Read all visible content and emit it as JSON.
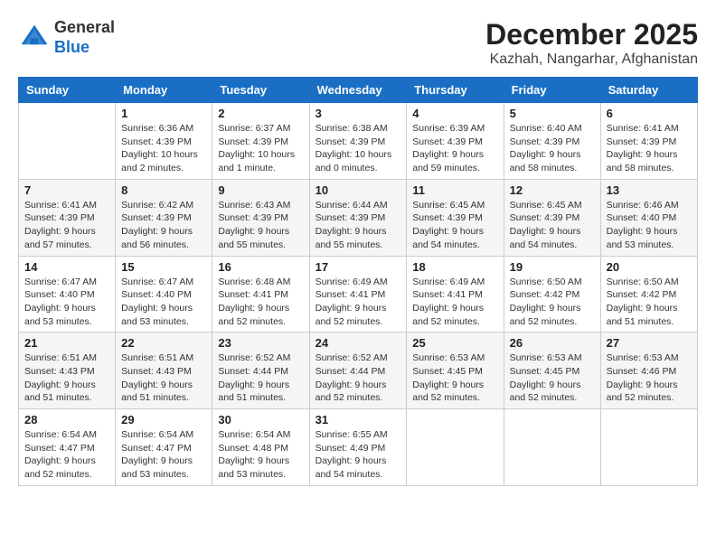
{
  "header": {
    "logo_line1": "General",
    "logo_line2": "Blue",
    "month": "December 2025",
    "location": "Kazhah, Nangarhar, Afghanistan"
  },
  "calendar": {
    "days_of_week": [
      "Sunday",
      "Monday",
      "Tuesday",
      "Wednesday",
      "Thursday",
      "Friday",
      "Saturday"
    ],
    "weeks": [
      [
        {
          "day": "",
          "info": ""
        },
        {
          "day": "1",
          "info": "Sunrise: 6:36 AM\nSunset: 4:39 PM\nDaylight: 10 hours\nand 2 minutes."
        },
        {
          "day": "2",
          "info": "Sunrise: 6:37 AM\nSunset: 4:39 PM\nDaylight: 10 hours\nand 1 minute."
        },
        {
          "day": "3",
          "info": "Sunrise: 6:38 AM\nSunset: 4:39 PM\nDaylight: 10 hours\nand 0 minutes."
        },
        {
          "day": "4",
          "info": "Sunrise: 6:39 AM\nSunset: 4:39 PM\nDaylight: 9 hours\nand 59 minutes."
        },
        {
          "day": "5",
          "info": "Sunrise: 6:40 AM\nSunset: 4:39 PM\nDaylight: 9 hours\nand 58 minutes."
        },
        {
          "day": "6",
          "info": "Sunrise: 6:41 AM\nSunset: 4:39 PM\nDaylight: 9 hours\nand 58 minutes."
        }
      ],
      [
        {
          "day": "7",
          "info": "Sunrise: 6:41 AM\nSunset: 4:39 PM\nDaylight: 9 hours\nand 57 minutes."
        },
        {
          "day": "8",
          "info": "Sunrise: 6:42 AM\nSunset: 4:39 PM\nDaylight: 9 hours\nand 56 minutes."
        },
        {
          "day": "9",
          "info": "Sunrise: 6:43 AM\nSunset: 4:39 PM\nDaylight: 9 hours\nand 55 minutes."
        },
        {
          "day": "10",
          "info": "Sunrise: 6:44 AM\nSunset: 4:39 PM\nDaylight: 9 hours\nand 55 minutes."
        },
        {
          "day": "11",
          "info": "Sunrise: 6:45 AM\nSunset: 4:39 PM\nDaylight: 9 hours\nand 54 minutes."
        },
        {
          "day": "12",
          "info": "Sunrise: 6:45 AM\nSunset: 4:39 PM\nDaylight: 9 hours\nand 54 minutes."
        },
        {
          "day": "13",
          "info": "Sunrise: 6:46 AM\nSunset: 4:40 PM\nDaylight: 9 hours\nand 53 minutes."
        }
      ],
      [
        {
          "day": "14",
          "info": "Sunrise: 6:47 AM\nSunset: 4:40 PM\nDaylight: 9 hours\nand 53 minutes."
        },
        {
          "day": "15",
          "info": "Sunrise: 6:47 AM\nSunset: 4:40 PM\nDaylight: 9 hours\nand 53 minutes."
        },
        {
          "day": "16",
          "info": "Sunrise: 6:48 AM\nSunset: 4:41 PM\nDaylight: 9 hours\nand 52 minutes."
        },
        {
          "day": "17",
          "info": "Sunrise: 6:49 AM\nSunset: 4:41 PM\nDaylight: 9 hours\nand 52 minutes."
        },
        {
          "day": "18",
          "info": "Sunrise: 6:49 AM\nSunset: 4:41 PM\nDaylight: 9 hours\nand 52 minutes."
        },
        {
          "day": "19",
          "info": "Sunrise: 6:50 AM\nSunset: 4:42 PM\nDaylight: 9 hours\nand 52 minutes."
        },
        {
          "day": "20",
          "info": "Sunrise: 6:50 AM\nSunset: 4:42 PM\nDaylight: 9 hours\nand 51 minutes."
        }
      ],
      [
        {
          "day": "21",
          "info": "Sunrise: 6:51 AM\nSunset: 4:43 PM\nDaylight: 9 hours\nand 51 minutes."
        },
        {
          "day": "22",
          "info": "Sunrise: 6:51 AM\nSunset: 4:43 PM\nDaylight: 9 hours\nand 51 minutes."
        },
        {
          "day": "23",
          "info": "Sunrise: 6:52 AM\nSunset: 4:44 PM\nDaylight: 9 hours\nand 51 minutes."
        },
        {
          "day": "24",
          "info": "Sunrise: 6:52 AM\nSunset: 4:44 PM\nDaylight: 9 hours\nand 52 minutes."
        },
        {
          "day": "25",
          "info": "Sunrise: 6:53 AM\nSunset: 4:45 PM\nDaylight: 9 hours\nand 52 minutes."
        },
        {
          "day": "26",
          "info": "Sunrise: 6:53 AM\nSunset: 4:45 PM\nDaylight: 9 hours\nand 52 minutes."
        },
        {
          "day": "27",
          "info": "Sunrise: 6:53 AM\nSunset: 4:46 PM\nDaylight: 9 hours\nand 52 minutes."
        }
      ],
      [
        {
          "day": "28",
          "info": "Sunrise: 6:54 AM\nSunset: 4:47 PM\nDaylight: 9 hours\nand 52 minutes."
        },
        {
          "day": "29",
          "info": "Sunrise: 6:54 AM\nSunset: 4:47 PM\nDaylight: 9 hours\nand 53 minutes."
        },
        {
          "day": "30",
          "info": "Sunrise: 6:54 AM\nSunset: 4:48 PM\nDaylight: 9 hours\nand 53 minutes."
        },
        {
          "day": "31",
          "info": "Sunrise: 6:55 AM\nSunset: 4:49 PM\nDaylight: 9 hours\nand 54 minutes."
        },
        {
          "day": "",
          "info": ""
        },
        {
          "day": "",
          "info": ""
        },
        {
          "day": "",
          "info": ""
        }
      ]
    ]
  }
}
